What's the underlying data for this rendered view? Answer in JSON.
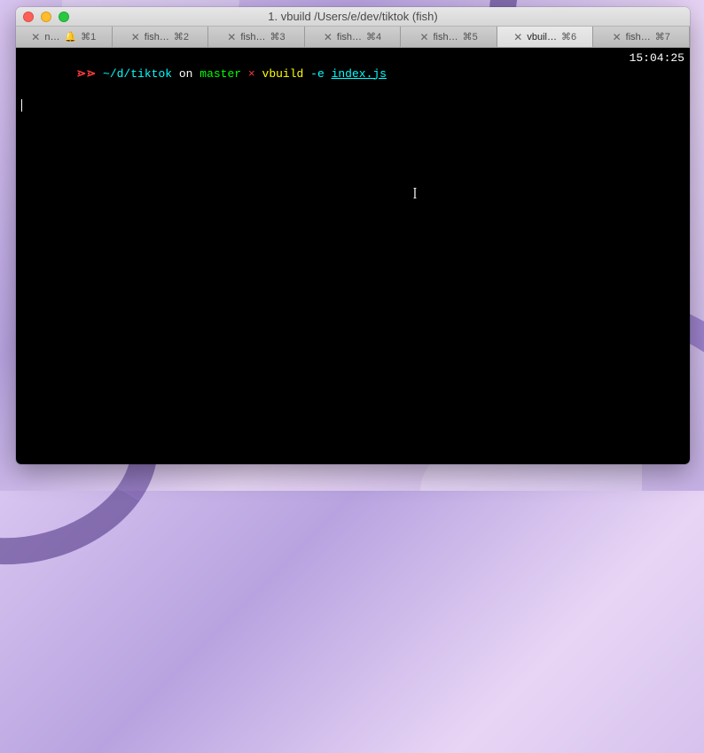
{
  "window": {
    "title": "1. vbuild  /Users/e/dev/tiktok (fish)"
  },
  "tabs": [
    {
      "label": "n…",
      "bell": true,
      "shortcut": "⌘1",
      "active": false
    },
    {
      "label": "fish…",
      "bell": false,
      "shortcut": "⌘2",
      "active": false
    },
    {
      "label": "fish…",
      "bell": false,
      "shortcut": "⌘3",
      "active": false
    },
    {
      "label": "fish…",
      "bell": false,
      "shortcut": "⌘4",
      "active": false
    },
    {
      "label": "fish…",
      "bell": false,
      "shortcut": "⌘5",
      "active": false
    },
    {
      "label": "vbuil…",
      "bell": false,
      "shortcut": "⌘6",
      "active": true
    },
    {
      "label": "fish…",
      "bell": false,
      "shortcut": "⌘7",
      "active": false
    }
  ],
  "prompt": {
    "icon": "⋗⋗",
    "path": "~/d/tiktok",
    "on": "on",
    "branch": "master",
    "x": "×",
    "command": "vbuild",
    "flag": "-e",
    "arg": "index.js",
    "time": "15:04:25"
  },
  "close_glyph": "✕",
  "bell_glyph": "🔔"
}
